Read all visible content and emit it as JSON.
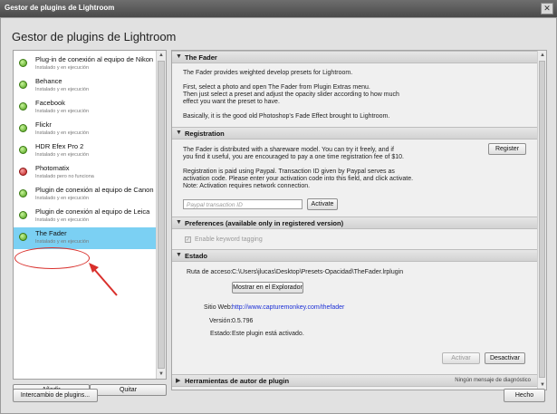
{
  "window": {
    "title": "Gestor de plugins de Lightroom",
    "close_glyph": "✕"
  },
  "heading": "Gestor de plugins de Lightroom",
  "plugins": [
    {
      "name": "Plug-in de conexión al equipo de Nikon",
      "status": "Instalado y en ejecución",
      "state": "ok"
    },
    {
      "name": "Behance",
      "status": "Instalado y en ejecución",
      "state": "ok"
    },
    {
      "name": "Facebook",
      "status": "Instalado y en ejecución",
      "state": "ok"
    },
    {
      "name": "Flickr",
      "status": "Instalado y en ejecución",
      "state": "ok"
    },
    {
      "name": "HDR Efex Pro 2",
      "status": "Instalado y en ejecución",
      "state": "ok"
    },
    {
      "name": "Photomatix",
      "status": "Instalado pero no funciona",
      "state": "error"
    },
    {
      "name": "Plugin de conexión al equipo de Canon",
      "status": "Instalado y en ejecución",
      "state": "ok"
    },
    {
      "name": "Plugin de conexión al equipo de Leica",
      "status": "Instalado y en ejecución",
      "state": "ok"
    },
    {
      "name": "The Fader",
      "status": "Instalado y en ejecución",
      "state": "ok",
      "selected": true
    }
  ],
  "list_buttons": {
    "add": "Añadir",
    "remove": "Quitar"
  },
  "fader": {
    "title": "The Fader",
    "lines": [
      "The Fader provides weighted develop presets for Lightroom.",
      "First, select a photo and open The Fader from Plugin Extras menu.",
      "Then just select a preset and adjust the opacity slider according to how much",
      "effect you want the preset to have.",
      "Basically, it is the good old Photoshop's Fade Effect brought to Lightroom."
    ]
  },
  "registration": {
    "title": "Registration",
    "lines": [
      "The Fader is distributed with a shareware model.  You can try it freely, and if",
      "you find it useful, you are encouraged to pay a one time registration fee of $10.",
      "Registration is paid using Paypal. Transaction ID given by Paypal serves as",
      "activation code.  Please enter your activation code into this field, and click activate.",
      "Note: Activation requires network connection."
    ],
    "register_button": "Register",
    "input_placeholder": "Paypal transaction ID",
    "activate_button": "Activate"
  },
  "preferences": {
    "title": "Preferences (available only in registered version)",
    "checkbox_label": "Enable keyword tagging",
    "checked": true
  },
  "estado": {
    "title": "Estado",
    "path_label": "Ruta de acceso:",
    "path_value": "C:\\Users\\jlucas\\Desktop\\Presets-Opacidad\\TheFader.lrplugin",
    "show_button": "Mostrar en el Explorador",
    "web_label": "Sitio Web:",
    "web_value": "http://www.capturemonkey.com/thefader",
    "version_label": "Versión:",
    "version_value": "0.5.796",
    "state_label": "Estado:",
    "state_value": "Este plugin está activado.",
    "activate_button": "Activar",
    "deactivate_button": "Desactivar"
  },
  "author_tools": {
    "title": "Herramientas de autor de plugin",
    "diagnostics": "Ningún mensaje de diagnóstico"
  },
  "footer": {
    "exchange_button": "Intercambio de plugins...",
    "done_button": "Hecho"
  },
  "icons": {
    "ok": "green-status-icon",
    "error": "red-status-icon",
    "annotation_color": "#d9302c"
  }
}
